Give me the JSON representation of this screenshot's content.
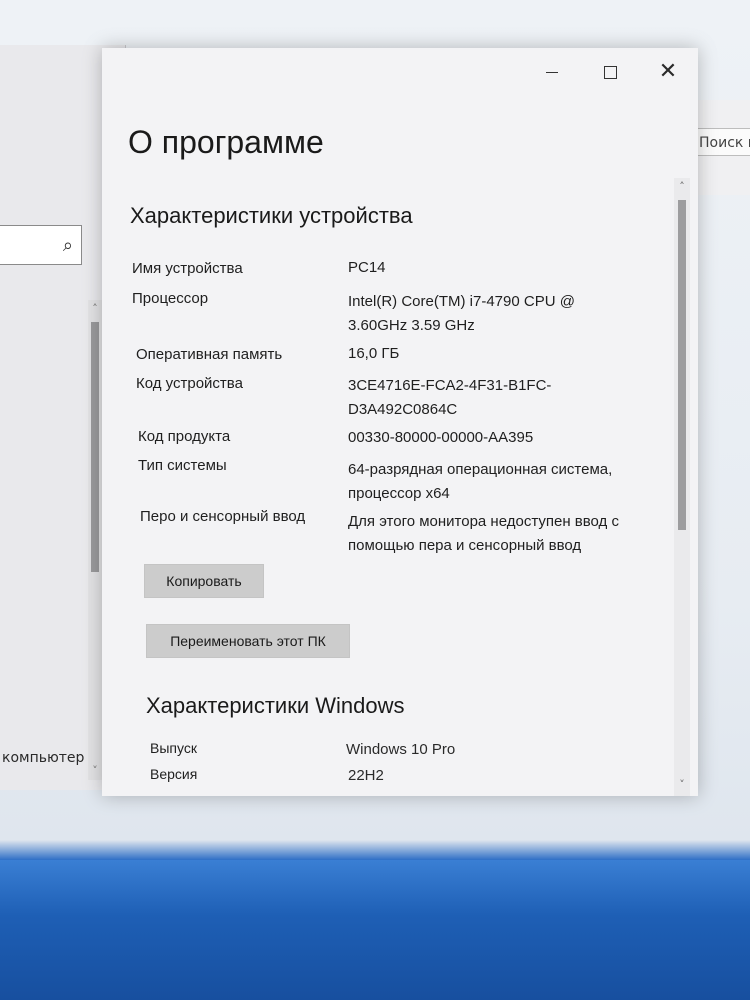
{
  "window": {
    "minimize_label": "",
    "title": "О программе"
  },
  "background": {
    "right_search": "Поиск в",
    "left_label": "компьютер"
  },
  "device_specs": {
    "heading": "Характеристики устройства",
    "rows": [
      {
        "label": "Имя устройства",
        "value": "PC14"
      },
      {
        "label": "Процессор",
        "value": "Intel(R) Core(TM) i7-4790 CPU @ 3.60GHz   3.59 GHz"
      },
      {
        "label": "Оперативная память",
        "value": "16,0 ГБ"
      },
      {
        "label": "Код устройства",
        "value": "3CE4716E-FCA2-4F31-B1FC-D3A492C0864C"
      },
      {
        "label": "Код продукта",
        "value": "00330-80000-00000-AA395"
      },
      {
        "label": "Тип системы",
        "value": "64-разрядная операционная система, процессор x64"
      },
      {
        "label": "Перо и сенсорный ввод",
        "value": "Для этого монитора недоступен ввод с помощью пера и сенсорный ввод"
      }
    ],
    "copy_button": "Копировать",
    "rename_button": "Переименовать этот ПК"
  },
  "windows_specs": {
    "heading": "Характеристики Windows",
    "rows": [
      {
        "label": "Выпуск",
        "value": "Windows 10 Pro"
      },
      {
        "label": "Версия",
        "value": "22H2"
      }
    ]
  },
  "icons": {
    "search": "search-icon",
    "close": "close-icon",
    "maximize": "maximize-icon",
    "minimize": "minimize-icon"
  }
}
